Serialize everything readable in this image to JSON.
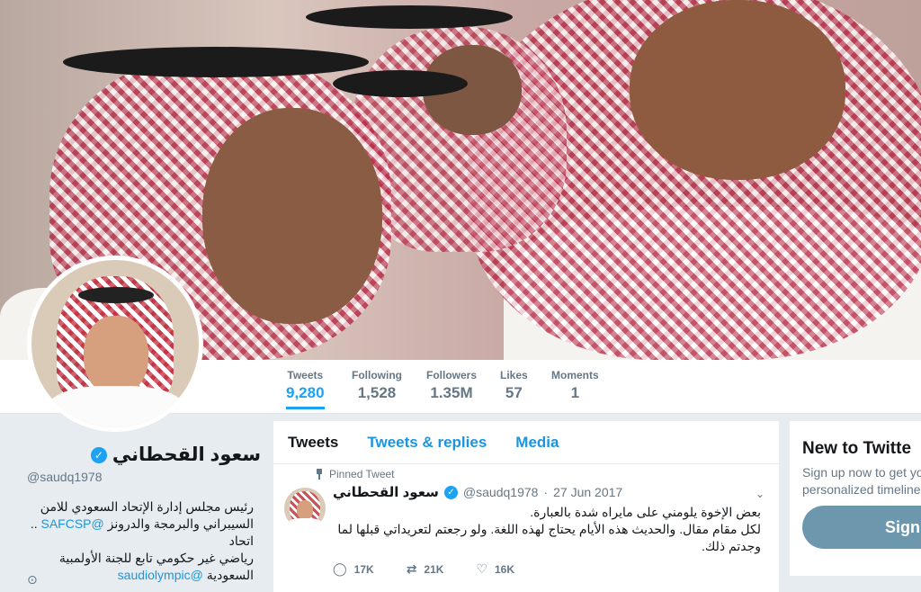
{
  "profile": {
    "name": "سعود القحطاني",
    "handle": "@saudq1978",
    "bio_line1": "رئيس مجلس إدارة الإتحاد السعودي للامن",
    "bio_line2_text": "السيبراني والبرمجة والدرونز",
    "bio_line2_link": "@SAFCSP",
    "bio_line2_tail": ".. اتحاد",
    "bio_line3": "رياضي غير حكومي تابع للجنة الأولمبية",
    "bio_line4_text": "السعودية",
    "bio_line4_link": "@saudiolympic"
  },
  "stats": [
    {
      "label": "Tweets",
      "value": "9,280"
    },
    {
      "label": "Following",
      "value": "1,528"
    },
    {
      "label": "Followers",
      "value": "1.35M"
    },
    {
      "label": "Likes",
      "value": "57"
    },
    {
      "label": "Moments",
      "value": "1"
    }
  ],
  "tabs": {
    "tweets": "Tweets",
    "replies": "Tweets & replies",
    "media": "Media"
  },
  "tweet": {
    "pinned_label": "Pinned Tweet",
    "name": "سعود القحطاني",
    "handle": "@saudq1978",
    "separator": "·",
    "date": "27 Jun 2017",
    "line1": "بعض الإخوة يلومني على مايراه شدة بالعبارة.",
    "line2": "لكل مقام مقال. والحديث هذه الأيام يحتاج لهذه اللغة. ولو رجعتم لتعريداتي قبلها لما",
    "line3": "وجدتم ذلك.",
    "replies": "17K",
    "retweets": "21K",
    "likes": "16K"
  },
  "sidebar": {
    "heading": "New to Twitte",
    "text_line1": "Sign up now to get yo",
    "text_line2": "personalized timeline!",
    "button": "Sign"
  },
  "colors": {
    "accent": "#1da1f2",
    "link": "#1b95e0",
    "signup_button": "#6d97ac"
  },
  "icons": [
    "verified-badge-icon",
    "pin-icon",
    "caret-down-icon",
    "reply-icon",
    "retweet-icon",
    "like-icon",
    "location-icon"
  ]
}
